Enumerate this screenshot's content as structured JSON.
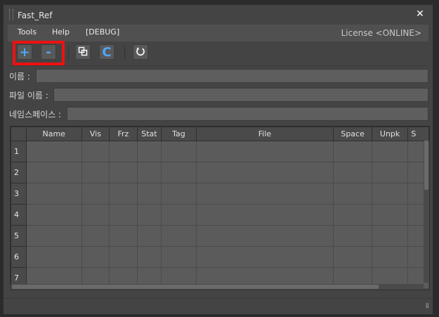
{
  "window": {
    "title": "Fast_Ref"
  },
  "menu": {
    "items": [
      "Tools",
      "Help",
      "[DEBUG]"
    ],
    "license": "License <ONLINE>"
  },
  "toolbar": {
    "add_label": "+",
    "remove_label": "-",
    "copy_icon": "copy-icon",
    "c_label": "C",
    "refresh_icon": "refresh-icon",
    "accent_color": "#4fa8ff",
    "highlight_color": "#ee1111"
  },
  "fields": {
    "name_label": "이름 :",
    "name_value": "",
    "filename_label": "파일 이름 :",
    "filename_value": "",
    "namespace_label": "네임스페이스 :",
    "namespace_value": ""
  },
  "table": {
    "columns": [
      "Name",
      "Vis",
      "Frz",
      "Stat",
      "Tag",
      "File",
      "Space",
      "Unpk",
      "S"
    ],
    "rows": [
      "1",
      "2",
      "3",
      "4",
      "5",
      "6",
      "7"
    ]
  },
  "status": {
    "grip": "⁞⁞"
  }
}
